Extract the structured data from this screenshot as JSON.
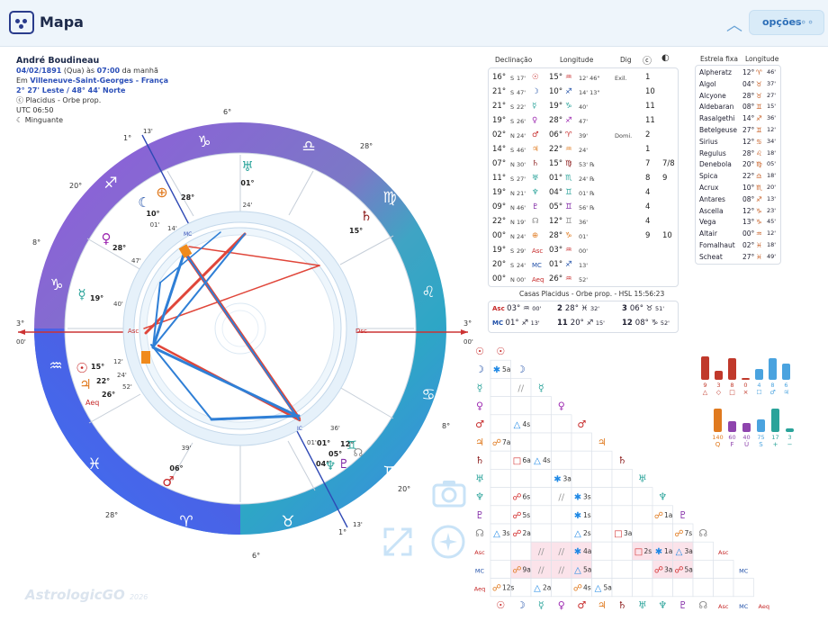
{
  "header": {
    "title": "Mapa",
    "options_label": "opções"
  },
  "person": {
    "name": "André Boudineau",
    "date": "04/02/1891",
    "weekday": "(Qua)",
    "at": "às",
    "time": "07:00",
    "period": "da manhã",
    "place_prefix": "Em",
    "place": "Villeneuve-Saint-Georges - França",
    "coords": "2° 27' Leste / 48° 44' Norte",
    "system": "Placidus - Orbe prop.",
    "utc": "UTC 06:50",
    "moon_phase": "Minguante"
  },
  "wheel": {
    "degree_labels": [
      "6°",
      "1°",
      "13'",
      "28°",
      "20°",
      "8°",
      "3°",
      "00'",
      "3°",
      "00'",
      "8°",
      "20°",
      "28°",
      "1°",
      "13'",
      "6°"
    ],
    "planet_labels": [
      "01°",
      "24'",
      "28°",
      "10°",
      "01'",
      "14'",
      "28°",
      "47'",
      "19°",
      "40'",
      "15°",
      "12'",
      "22°",
      "24'",
      "26°",
      "52'",
      "06°",
      "39'",
      "36'",
      "01°",
      "01'",
      "12°",
      "05°",
      "04°",
      "15°"
    ],
    "aeq_label": "Aeq",
    "asc_label": "Asc",
    "dsc_label": "Dsc",
    "mc_label": "MC",
    "ic_label": "IC"
  },
  "planets_table": {
    "headers": [
      "Declinação",
      "Longitude",
      "Dig"
    ],
    "rows": [
      {
        "sym": "☉",
        "color": "#c62828",
        "dec": "16°",
        "ns": "S",
        "dm": "17'",
        "lon": "15°",
        "sign": "♒",
        "sm": "12' 46\"",
        "dig": "Exil.",
        "h1": "1",
        "h2": ""
      },
      {
        "sym": "☽",
        "color": "#1f4fa8",
        "dec": "21°",
        "ns": "S",
        "dm": "47'",
        "lon": "10°",
        "sign": "♐",
        "sm": "14' 13\"",
        "dig": "",
        "h1": "10",
        "h2": ""
      },
      {
        "sym": "☿",
        "color": "#2aa39a",
        "dec": "21°",
        "ns": "S",
        "dm": "22'",
        "lon": "19°",
        "sign": "♑",
        "sm": "40'",
        "dig": "",
        "h1": "11",
        "h2": ""
      },
      {
        "sym": "♀",
        "color": "#9c27b0",
        "dec": "19°",
        "ns": "S",
        "dm": "26'",
        "lon": "28°",
        "sign": "♐",
        "sm": "47'",
        "dig": "",
        "h1": "11",
        "h2": ""
      },
      {
        "sym": "♂",
        "color": "#c62828",
        "dec": "02°",
        "ns": "N",
        "dm": "24'",
        "lon": "06°",
        "sign": "♈",
        "sm": "39'",
        "dig": "Domi.",
        "h1": "2",
        "h2": ""
      },
      {
        "sym": "♃",
        "color": "#e07a1f",
        "dec": "14°",
        "ns": "S",
        "dm": "46'",
        "lon": "22°",
        "sign": "♒",
        "sm": "24'",
        "dig": "",
        "h1": "1",
        "h2": ""
      },
      {
        "sym": "♄",
        "color": "#8b1a1a",
        "dec": "07°",
        "ns": "N",
        "dm": "30'",
        "lon": "15°",
        "sign": "♍",
        "sm": "53' ℞",
        "dig": "",
        "h1": "7",
        "h2": "7/8"
      },
      {
        "sym": "♅",
        "color": "#2aa39a",
        "dec": "11°",
        "ns": "S",
        "dm": "27'",
        "lon": "01°",
        "sign": "♏",
        "sm": "24' ℞",
        "dig": "",
        "h1": "8",
        "h2": "9"
      },
      {
        "sym": "♆",
        "color": "#2aa39a",
        "dec": "19°",
        "ns": "N",
        "dm": "21'",
        "lon": "04°",
        "sign": "♊",
        "sm": "01' ℞",
        "dig": "",
        "h1": "4",
        "h2": ""
      },
      {
        "sym": "♇",
        "color": "#7b1fa2",
        "dec": "09°",
        "ns": "N",
        "dm": "46'",
        "lon": "05°",
        "sign": "♊",
        "sm": "56' ℞",
        "dig": "",
        "h1": "4",
        "h2": ""
      },
      {
        "sym": "☊",
        "color": "#888888",
        "dec": "22°",
        "ns": "N",
        "dm": "19'",
        "lon": "12°",
        "sign": "♊",
        "sm": "36'",
        "dig": "",
        "h1": "4",
        "h2": ""
      },
      {
        "sym": "⊕",
        "color": "#e07a1f",
        "dec": "00°",
        "ns": "N",
        "dm": "24'",
        "lon": "28°",
        "sign": "♑",
        "sm": "01'",
        "dig": "",
        "h1": "9",
        "h2": "10"
      },
      {
        "sym": "Asc",
        "color": "#c62828",
        "dec": "19°",
        "ns": "S",
        "dm": "29'",
        "lon": "03°",
        "sign": "♒",
        "sm": "00'",
        "dig": "",
        "h1": "",
        "h2": ""
      },
      {
        "sym": "MC",
        "color": "#1f4fa8",
        "dec": "20°",
        "ns": "S",
        "dm": "24'",
        "lon": "01°",
        "sign": "♐",
        "sm": "13'",
        "dig": "",
        "h1": "",
        "h2": ""
      },
      {
        "sym": "Aeq",
        "color": "#c62828",
        "dec": "00°",
        "ns": "N",
        "dm": "00'",
        "lon": "26°",
        "sign": "♒",
        "sm": "52'",
        "dig": "",
        "h1": "",
        "h2": ""
      }
    ]
  },
  "houses": {
    "title": "Casas Placidus - Orbe prop. - HSL 15:56:23",
    "cells": [
      {
        "n": "Asc",
        "deg": "03°",
        "sign": "♒",
        "min": "00'"
      },
      {
        "n": "2",
        "deg": "28°",
        "sign": "♓",
        "min": "32'"
      },
      {
        "n": "3",
        "deg": "06°",
        "sign": "♉",
        "min": "51'"
      },
      {
        "n": "MC",
        "deg": "01°",
        "sign": "♐",
        "min": "13'"
      },
      {
        "n": "11",
        "deg": "20°",
        "sign": "♐",
        "min": "15'"
      },
      {
        "n": "12",
        "deg": "08°",
        "sign": "♑",
        "min": "52'"
      }
    ]
  },
  "stars": {
    "headers": [
      "Estrela fixa",
      "Longitude"
    ],
    "rows": [
      {
        "name": "Alpheratz",
        "deg": "12°",
        "sign": "♈",
        "min": "46'"
      },
      {
        "name": "Algol",
        "deg": "04°",
        "sign": "♉",
        "min": "37'"
      },
      {
        "name": "Alcyone",
        "deg": "28°",
        "sign": "♉",
        "min": "27'"
      },
      {
        "name": "Aldebaran",
        "deg": "08°",
        "sign": "♊",
        "min": "15'"
      },
      {
        "name": "Rasalgethi",
        "deg": "14°",
        "sign": "♐",
        "min": "36'"
      },
      {
        "name": "Betelgeuse",
        "deg": "27°",
        "sign": "♊",
        "min": "12'"
      },
      {
        "name": "Sirius",
        "deg": "12°",
        "sign": "♋",
        "min": "34'"
      },
      {
        "name": "Regulus",
        "deg": "28°",
        "sign": "♌",
        "min": "18'"
      },
      {
        "name": "Denebola",
        "deg": "20°",
        "sign": "♍",
        "min": "05'"
      },
      {
        "name": "Spica",
        "deg": "22°",
        "sign": "♎",
        "min": "18'"
      },
      {
        "name": "Acrux",
        "deg": "10°",
        "sign": "♏",
        "min": "20'"
      },
      {
        "name": "Antares",
        "deg": "08°",
        "sign": "♐",
        "min": "13'"
      },
      {
        "name": "Ascella",
        "deg": "12°",
        "sign": "♑",
        "min": "23'"
      },
      {
        "name": "Vega",
        "deg": "13°",
        "sign": "♑",
        "min": "45'"
      },
      {
        "name": "Altair",
        "deg": "00°",
        "sign": "♒",
        "min": "12'"
      },
      {
        "name": "Fomalhaut",
        "deg": "02°",
        "sign": "♓",
        "min": "18'"
      },
      {
        "name": "Scheat",
        "deg": "27°",
        "sign": "♓",
        "min": "49'"
      }
    ]
  },
  "aspect_cells": [
    {
      "r": 1,
      "c": 0,
      "g": "✱",
      "t": "5a",
      "col": "#1e88e5",
      "bg": ""
    },
    {
      "r": 2,
      "c": 0,
      "g": "",
      "t": "",
      "col": "",
      "bg": ""
    },
    {
      "r": 2,
      "c": 1,
      "g": "//",
      "t": "",
      "col": "#999",
      "bg": ""
    },
    {
      "r": 4,
      "c": 1,
      "g": "△",
      "t": "4s",
      "col": "#1e88e5",
      "bg": ""
    },
    {
      "r": 5,
      "c": 0,
      "g": "☍",
      "t": "7a",
      "col": "#e07a1f",
      "bg": ""
    },
    {
      "r": 6,
      "c": 1,
      "g": "□",
      "t": "6a",
      "col": "#d32f2f",
      "bg": ""
    },
    {
      "r": 6,
      "c": 2,
      "g": "△",
      "t": "4s",
      "col": "#1e88e5",
      "bg": ""
    },
    {
      "r": 7,
      "c": 3,
      "g": "✱",
      "t": "3a",
      "col": "#1e88e5",
      "bg": ""
    },
    {
      "r": 8,
      "c": 1,
      "g": "☍",
      "t": "6s",
      "col": "#d32f2f",
      "bg": ""
    },
    {
      "r": 8,
      "c": 3,
      "g": "//",
      "t": "",
      "col": "#999",
      "bg": ""
    },
    {
      "r": 8,
      "c": 4,
      "g": "✱",
      "t": "3s",
      "col": "#1e88e5",
      "bg": ""
    },
    {
      "r": 9,
      "c": 1,
      "g": "☍",
      "t": "5s",
      "col": "#d32f2f",
      "bg": ""
    },
    {
      "r": 9,
      "c": 4,
      "g": "✱",
      "t": "1s",
      "col": "#1e88e5",
      "bg": ""
    },
    {
      "r": 9,
      "c": 8,
      "g": "☍",
      "t": "1a",
      "col": "#e07a1f",
      "bg": ""
    },
    {
      "r": 10,
      "c": 0,
      "g": "△",
      "t": "3s",
      "col": "#1e88e5",
      "bg": ""
    },
    {
      "r": 10,
      "c": 1,
      "g": "☍",
      "t": "2a",
      "col": "#d32f2f",
      "bg": ""
    },
    {
      "r": 10,
      "c": 4,
      "g": "△",
      "t": "2s",
      "col": "#1e88e5",
      "bg": ""
    },
    {
      "r": 10,
      "c": 6,
      "g": "□",
      "t": "3a",
      "col": "#d32f2f",
      "bg": ""
    },
    {
      "r": 10,
      "c": 9,
      "g": "☍",
      "t": "7s",
      "col": "#e07a1f",
      "bg": ""
    },
    {
      "r": 11,
      "c": 2,
      "g": "//",
      "t": "",
      "col": "#999",
      "bg": "#fbe3ea"
    },
    {
      "r": 11,
      "c": 3,
      "g": "//",
      "t": "",
      "col": "#999",
      "bg": "#fbe3ea"
    },
    {
      "r": 11,
      "c": 4,
      "g": "✱",
      "t": "4a",
      "col": "#1e88e5",
      "bg": "#fbe3ea"
    },
    {
      "r": 11,
      "c": 7,
      "g": "□",
      "t": "2s",
      "col": "#d32f2f",
      "bg": "#fbe3ea"
    },
    {
      "r": 11,
      "c": 8,
      "g": "✱",
      "t": "1a",
      "col": "#1e88e5",
      "bg": "#fbe3ea"
    },
    {
      "r": 11,
      "c": 9,
      "g": "△",
      "t": "3a",
      "col": "#1e88e5",
      "bg": "#fbe3ea"
    },
    {
      "r": 12,
      "c": 1,
      "g": "☍",
      "t": "9a",
      "col": "#e07a1f",
      "bg": "#fbe3ea"
    },
    {
      "r": 12,
      "c": 2,
      "g": "//",
      "t": "",
      "col": "#999",
      "bg": "#fbe3ea"
    },
    {
      "r": 12,
      "c": 3,
      "g": "//",
      "t": "",
      "col": "#999",
      "bg": "#fbe3ea"
    },
    {
      "r": 12,
      "c": 4,
      "g": "△",
      "t": "5a",
      "col": "#1e88e5",
      "bg": "#fbe3ea"
    },
    {
      "r": 12,
      "c": 8,
      "g": "☍",
      "t": "3a",
      "col": "#d32f2f",
      "bg": "#fbe3ea"
    },
    {
      "r": 12,
      "c": 9,
      "g": "☍",
      "t": "5a",
      "col": "#d32f2f",
      "bg": "#fbe3ea"
    },
    {
      "r": 13,
      "c": 0,
      "g": "☍",
      "t": "12s",
      "col": "#e07a1f",
      "bg": ""
    },
    {
      "r": 13,
      "c": 2,
      "g": "△",
      "t": "2a",
      "col": "#1e88e5",
      "bg": ""
    },
    {
      "r": 13,
      "c": 4,
      "g": "☍",
      "t": "4s",
      "col": "#e07a1f",
      "bg": ""
    },
    {
      "r": 13,
      "c": 5,
      "g": "△",
      "t": "5a",
      "col": "#1e88e5",
      "bg": ""
    }
  ],
  "aspect_symbols": [
    "☉",
    "☽",
    "☿",
    "♀",
    "♂",
    "♃",
    "♄",
    "♅",
    "♆",
    "♇",
    "☊",
    "Asc",
    "MC",
    "Aeq"
  ],
  "aspect_symbol_colors": [
    "#c62828",
    "#1f4fa8",
    "#2aa39a",
    "#9c27b0",
    "#c62828",
    "#e07a1f",
    "#8b1a1a",
    "#2aa39a",
    "#2aa39a",
    "#7b1fa2",
    "#888888",
    "#c62828",
    "#1f4fa8",
    "#c62828"
  ],
  "bars_top": [
    {
      "v": "9",
      "l": "△",
      "h": 26,
      "c": "#c0392b"
    },
    {
      "v": "3",
      "l": "◇",
      "h": 10,
      "c": "#c0392b"
    },
    {
      "v": "8",
      "l": "□",
      "h": 24,
      "c": "#c0392b"
    },
    {
      "v": "0",
      "l": "×",
      "h": 2,
      "c": "#c0392b"
    },
    {
      "v": "4",
      "l": "☐",
      "h": 12,
      "c": "#4aa3df"
    },
    {
      "v": "8",
      "l": "♂",
      "h": 24,
      "c": "#4aa3df"
    },
    {
      "v": "6",
      "l": "♃",
      "h": 18,
      "c": "#4aa3df"
    }
  ],
  "bars_bottom": [
    {
      "v": "140",
      "l": "Q",
      "h": 26,
      "c": "#e07a1f"
    },
    {
      "v": "60",
      "l": "F",
      "h": 12,
      "c": "#8e44ad"
    },
    {
      "v": "40",
      "l": "Ú",
      "h": 10,
      "c": "#8e44ad"
    },
    {
      "v": "75",
      "l": "S",
      "h": 14,
      "c": "#4aa3df"
    },
    {
      "v": "17",
      "l": "+",
      "h": 26,
      "c": "#2aa39a"
    },
    {
      "v": "3",
      "l": "−",
      "h": 4,
      "c": "#2aa39a"
    }
  ],
  "watermark": {
    "brand": "Astrologic",
    "brand2": "GO",
    "year": "2026"
  }
}
